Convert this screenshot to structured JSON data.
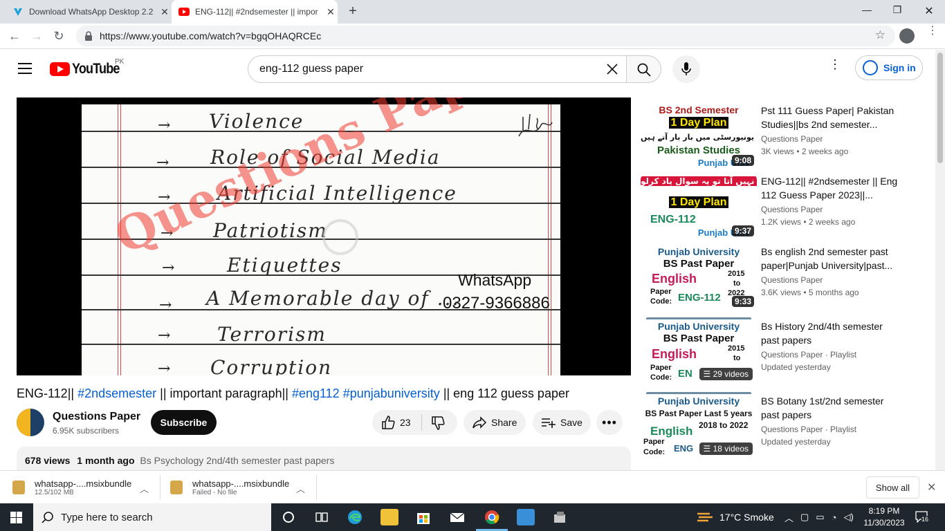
{
  "browser": {
    "tabs": [
      {
        "title": "Download WhatsApp Desktop 2.2",
        "icon": "download-favicon"
      },
      {
        "title": "ENG-112|| #2ndsemester || impor",
        "icon": "youtube-favicon"
      }
    ],
    "url": "https://www.youtube.com/watch?v=bgqOHAQRCEc"
  },
  "youtube": {
    "country": "PK",
    "search_value": "eng-112 guess paper",
    "sign_in": "Sign in"
  },
  "player": {
    "lines": [
      "Violence",
      "Role of Social Media",
      "Artificial Intelligence",
      "Patriotism",
      "Etiquettes",
      "A Memorable day of ...",
      "Terrorism",
      "Corruption"
    ],
    "watermark": "Questions Paper",
    "whatsapp_label": "WhatsApp",
    "whatsapp_number": "0327-9366886"
  },
  "video": {
    "title_parts": [
      "ENG-112|| ",
      "#2ndsemester",
      " || important paragraph|| ",
      "#eng112",
      " ",
      "#punjabuniversity",
      " || eng 112 guess paper"
    ],
    "channel": "Questions Paper",
    "subscribers": "6.95K subscribers",
    "subscribe": "Subscribe",
    "likes": "23",
    "share": "Share",
    "save": "Save",
    "views": "678 views",
    "age": "1 month ago",
    "desc_preview": "Bs Psychology 2nd/4th semester past papers"
  },
  "recommendations": [
    {
      "title": "Pst 111 Guess Paper| Pakistan Studies||bs 2nd semester...",
      "channel": "Questions Paper",
      "meta": "3K views  • 2 weeks ago",
      "duration": "9:08",
      "thumb_lines": [
        "BS 2nd Semester",
        "1 Day Plan",
        "یہ سوال پنجاب یونیورسٹی میں بار بار آتے ہیں",
        "Pakistan Studies",
        "Punjab Univ"
      ]
    },
    {
      "title": "ENG-112|| #2ndsemester || Eng 112 Guess Paper 2023||...",
      "channel": "Questions Paper",
      "meta": "1.2K views  • 2 weeks ago",
      "duration": "9:37",
      "thumb_lines": [
        "اگر کچھ نہیں آتا تو یہ سوال یاد کرلو",
        "1 Day Plan",
        "ENG-112",
        "Punjab Univ"
      ]
    },
    {
      "title": "Bs english 2nd semester past paper|Punjab University|past...",
      "channel": "Questions Paper",
      "meta": "3.6K views  • 5 months ago",
      "duration": "9:33",
      "thumb_lines": [
        "Punjab University",
        "BS Past Paper",
        "English",
        "2015",
        "to",
        "2022",
        "Paper",
        "Code:",
        "ENG-112"
      ]
    },
    {
      "title": "Bs History 2nd/4th semester past papers",
      "channel": "Questions Paper · Playlist",
      "meta": "Updated yesterday",
      "count": "29 videos",
      "thumb_lines": [
        "Punjab University",
        "BS Past Paper",
        "English",
        "2015",
        "to",
        "Paper",
        "Code:",
        "EN"
      ]
    },
    {
      "title": "BS Botany 1st/2nd semester past papers",
      "channel": "Questions Paper · Playlist",
      "meta": "Updated yesterday",
      "count": "18 videos",
      "thumb_lines": [
        "Punjab University",
        "BS Past Paper Last 5 years",
        "2018 to 2022",
        "English",
        "Paper",
        "Code:",
        "ENG"
      ]
    }
  ],
  "downloads": [
    {
      "name": "whatsapp-....msixbundle",
      "status": "12.5/102 MB"
    },
    {
      "name": "whatsapp-....msixbundle",
      "status": "Failed - No file"
    }
  ],
  "downloads_show_all": "Show all",
  "taskbar": {
    "search_placeholder": "Type here to search",
    "weather": "17°C  Smoke",
    "time": "8:19 PM",
    "date": "11/30/2023",
    "notifications": "16"
  },
  "colors": {
    "youtube_red": "#ff0000",
    "link_blue": "#065fd4",
    "taskbar": "#20262e"
  }
}
